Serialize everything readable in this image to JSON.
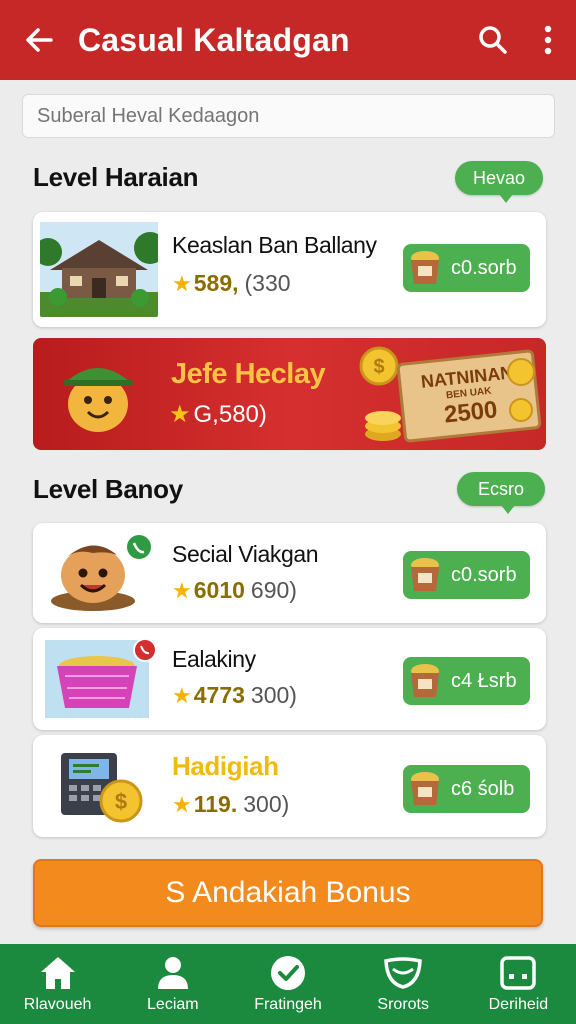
{
  "header": {
    "title": "Casual Kaltadgan",
    "bg_color": "#c62828"
  },
  "search": {
    "placeholder": "Suberal Heval Kedaagon"
  },
  "section1": {
    "title": "Level Haraian",
    "pill": "Hevao"
  },
  "section2": {
    "title": "Level Banoy",
    "pill": "Ecsro"
  },
  "items": [
    {
      "name": "Keaslan Ban Ballany",
      "rating": "589,",
      "sub": "(330",
      "button": "c0.sorb",
      "thumb_icon": "house-image"
    },
    {
      "name": "Secial Viakgan",
      "rating": "6010",
      "sub": "690)",
      "button": "c0.sorb",
      "thumb_icon": "mascot-icon"
    },
    {
      "name": "Ealakiny",
      "rating": "4773",
      "sub": "300)",
      "button": "c4 Łsrb",
      "thumb_icon": "basket-icon"
    },
    {
      "name": "Hadigiah",
      "rating": "119.",
      "sub": "300)",
      "button": "c6 śolb",
      "thumb_icon": "cash-register-icon"
    }
  ],
  "promo": {
    "title": "Jefe Heclay",
    "rating": "G,580)",
    "board_line1": "NATNINAN",
    "board_line2": "BEN UAK",
    "board_line3": "2500",
    "title_color": "#ffc542"
  },
  "bonus_button": "S Andakiah Bonus",
  "bottom_nav": [
    {
      "label": "Rlavoueh",
      "icon": "home-icon"
    },
    {
      "label": "Leciam",
      "icon": "person-icon"
    },
    {
      "label": "Fratingeh",
      "icon": "check-circle-icon"
    },
    {
      "label": "Srorots",
      "icon": "mask-icon"
    },
    {
      "label": "Deriheid",
      "icon": "device-icon"
    }
  ],
  "accent_green": "#4caf50",
  "bonus_color": "#f28a1e"
}
